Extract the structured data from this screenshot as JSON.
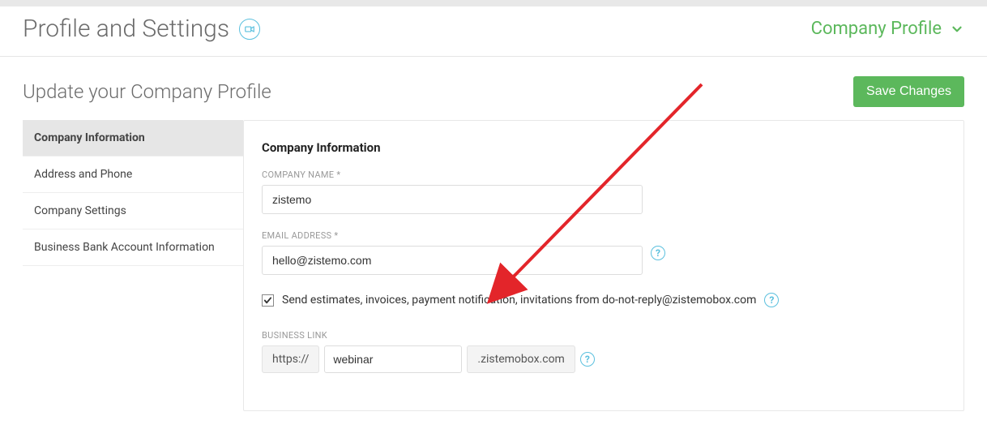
{
  "header": {
    "page_title": "Profile and Settings",
    "dropdown_label": "Company Profile"
  },
  "subheader": {
    "title": "Update your Company Profile",
    "save_label": "Save Changes"
  },
  "sidebar": {
    "items": [
      {
        "label": "Company Information",
        "active": true
      },
      {
        "label": "Address and Phone",
        "active": false
      },
      {
        "label": "Company Settings",
        "active": false
      },
      {
        "label": "Business Bank Account Information",
        "active": false
      }
    ]
  },
  "form": {
    "section_heading": "Company Information",
    "company_name": {
      "label": "COMPANY NAME *",
      "value": "zistemo"
    },
    "email": {
      "label": "EMAIL ADDRESS *",
      "value": "hello@zistemo.com"
    },
    "checkbox_text": "Send estimates, invoices, payment notification, invitations from do-not-reply@zistemobox.com",
    "checkbox_checked": true,
    "business_link": {
      "label": "BUSINESS LINK",
      "prefix": "https://",
      "subdomain": "webinar",
      "suffix": ".zistemobox.com"
    }
  }
}
